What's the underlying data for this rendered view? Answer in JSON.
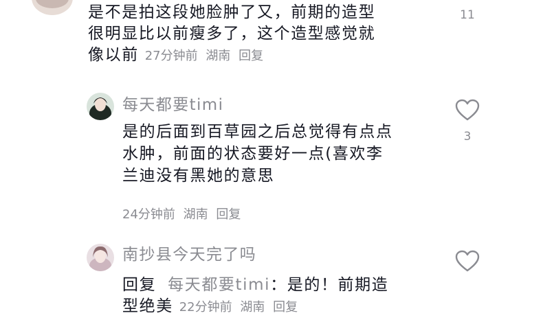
{
  "comments": [
    {
      "text_lines": [
        "是不是拍这段她脸肿了又，前期的造型",
        "很明显比以前瘦多了，这个造型感觉就",
        "像以前"
      ],
      "time": "27分钟前",
      "location": "湖南",
      "reply_label": "回复",
      "like_count": "11"
    },
    {
      "username": "每天都要timi",
      "text_lines": [
        "是的后面到百草园之后总觉得有点点",
        "水肿，前面的状态要好一点(喜欢李",
        "兰迪没有黑她的意思"
      ],
      "time": "24分钟前",
      "location": "湖南",
      "reply_label": "回复",
      "like_count": "3"
    },
    {
      "username": "南抄县今天完了吗",
      "reply_prefix": "回复",
      "reply_target": "每天都要timi",
      "text_after_target": "：是的！前期造",
      "text_line2": "型绝美",
      "time": "22分钟前",
      "location": "湖南",
      "reply_label": "回复"
    }
  ]
}
